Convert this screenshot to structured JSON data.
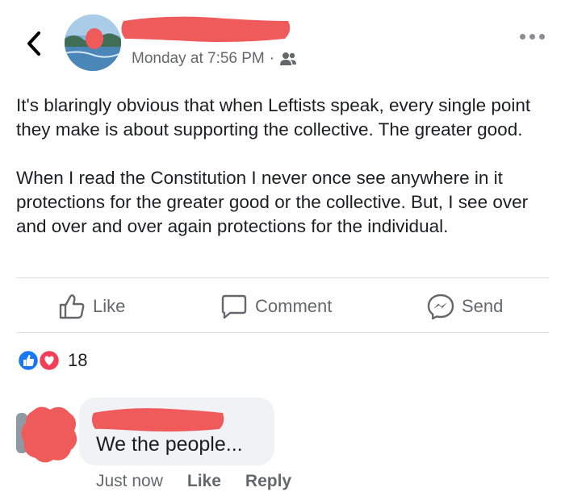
{
  "post": {
    "timestamp": "Monday at 7:56 PM",
    "separator": "·",
    "audience_icon": "friends-icon",
    "paragraphs": [
      "It's blaringly obvious that when Leftists speak, every single point they make is about supporting the collective. The greater good.",
      "When I read the Constitution I never once see anywhere in it protections for the greater good or the collective. But, I see over and over and over again protections for the individual."
    ]
  },
  "actions": {
    "like_label": "Like",
    "comment_label": "Comment",
    "send_label": "Send"
  },
  "reactions": {
    "count": "18",
    "icons": [
      "like-reaction-icon",
      "love-reaction-icon"
    ]
  },
  "comment": {
    "text": "We the people...",
    "time": "Just now",
    "like_label": "Like",
    "reply_label": "Reply"
  },
  "colors": {
    "redaction": "#ef5b5b",
    "secondary_text": "#65676b",
    "bubble": "#f0f2f5",
    "like_blue": "#1877f2",
    "love_red": "#f33e58"
  }
}
